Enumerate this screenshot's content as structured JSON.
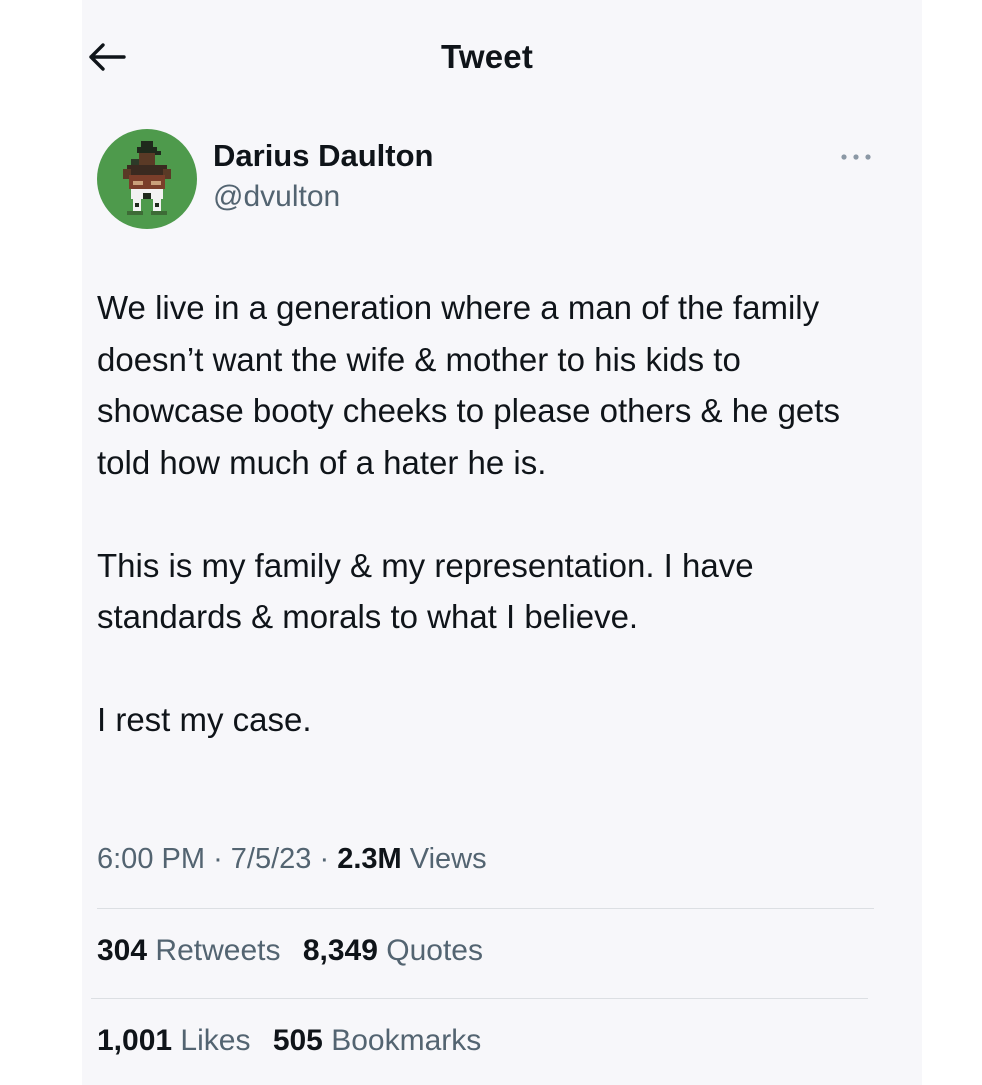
{
  "header": {
    "title": "Tweet",
    "back_icon": "arrow-left-icon"
  },
  "author": {
    "name": "Darius Daulton",
    "handle": "@dvulton",
    "avatar_icon": "pixel-art-character-avatar",
    "avatar_bg": "#4e9a4c"
  },
  "tweet": {
    "paragraphs": [
      "We live in a generation where a man of the family doesn’t want the wife & mother to his kids to showcase booty cheeks to please others & he gets told how much of a hater he is.",
      "This is my family & my representation. I have standards & morals to what I believe.",
      "I rest my case."
    ]
  },
  "meta": {
    "time": "6:00 PM",
    "separator": "·",
    "date": "7/5/23",
    "views_count": "2.3M",
    "views_label": "Views"
  },
  "stats": {
    "retweets_count": "304",
    "retweets_label": "Retweets",
    "quotes_count": "8,349",
    "quotes_label": "Quotes",
    "likes_count": "1,001",
    "likes_label": "Likes",
    "bookmarks_count": "505",
    "bookmarks_label": "Bookmarks"
  },
  "colors": {
    "text_primary": "#0f1419",
    "text_secondary": "#536471",
    "divider": "#dcdfe3"
  }
}
